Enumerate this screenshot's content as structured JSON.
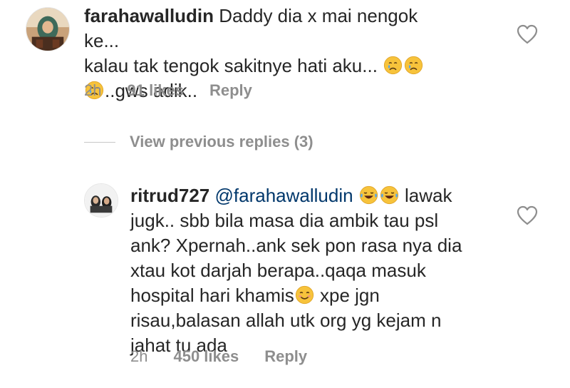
{
  "comments": [
    {
      "username": "farahawalludin",
      "line1": "Daddy dia x mai nengok ke...",
      "line2": "kalau tak tengok sakitnye hati aku...",
      "line3": "..gws adik..",
      "time": "2h",
      "likes": "91 likes",
      "reply": "Reply"
    },
    {
      "username": "ritrud727",
      "mention": "@farahawalludin",
      "after_emoji": "lawak",
      "line2": "jugk.. sbb bila masa dia ambik tau psl",
      "line3": "ank? Xpernah..ank sek pon rasa nya dia",
      "line4": "xtau kot darjah berapa..qaqa masuk",
      "line5a": "hospital hari khamis",
      "line5b": "xpe jgn",
      "line6": "risau,balasan allah utk org yg kejam n",
      "line7": "jahat tu ada",
      "time": "2h",
      "likes": "450 likes",
      "reply": "Reply"
    }
  ],
  "view_previous": "View previous replies (3)",
  "icons": {
    "like": "heart-outline-icon",
    "cry": "crying-face-emoji",
    "laugh": "tears-of-joy-emoji",
    "smile": "smiling-face-emoji"
  },
  "colors": {
    "text": "#262626",
    "meta": "#8e8e8e",
    "mention": "#00376b"
  }
}
